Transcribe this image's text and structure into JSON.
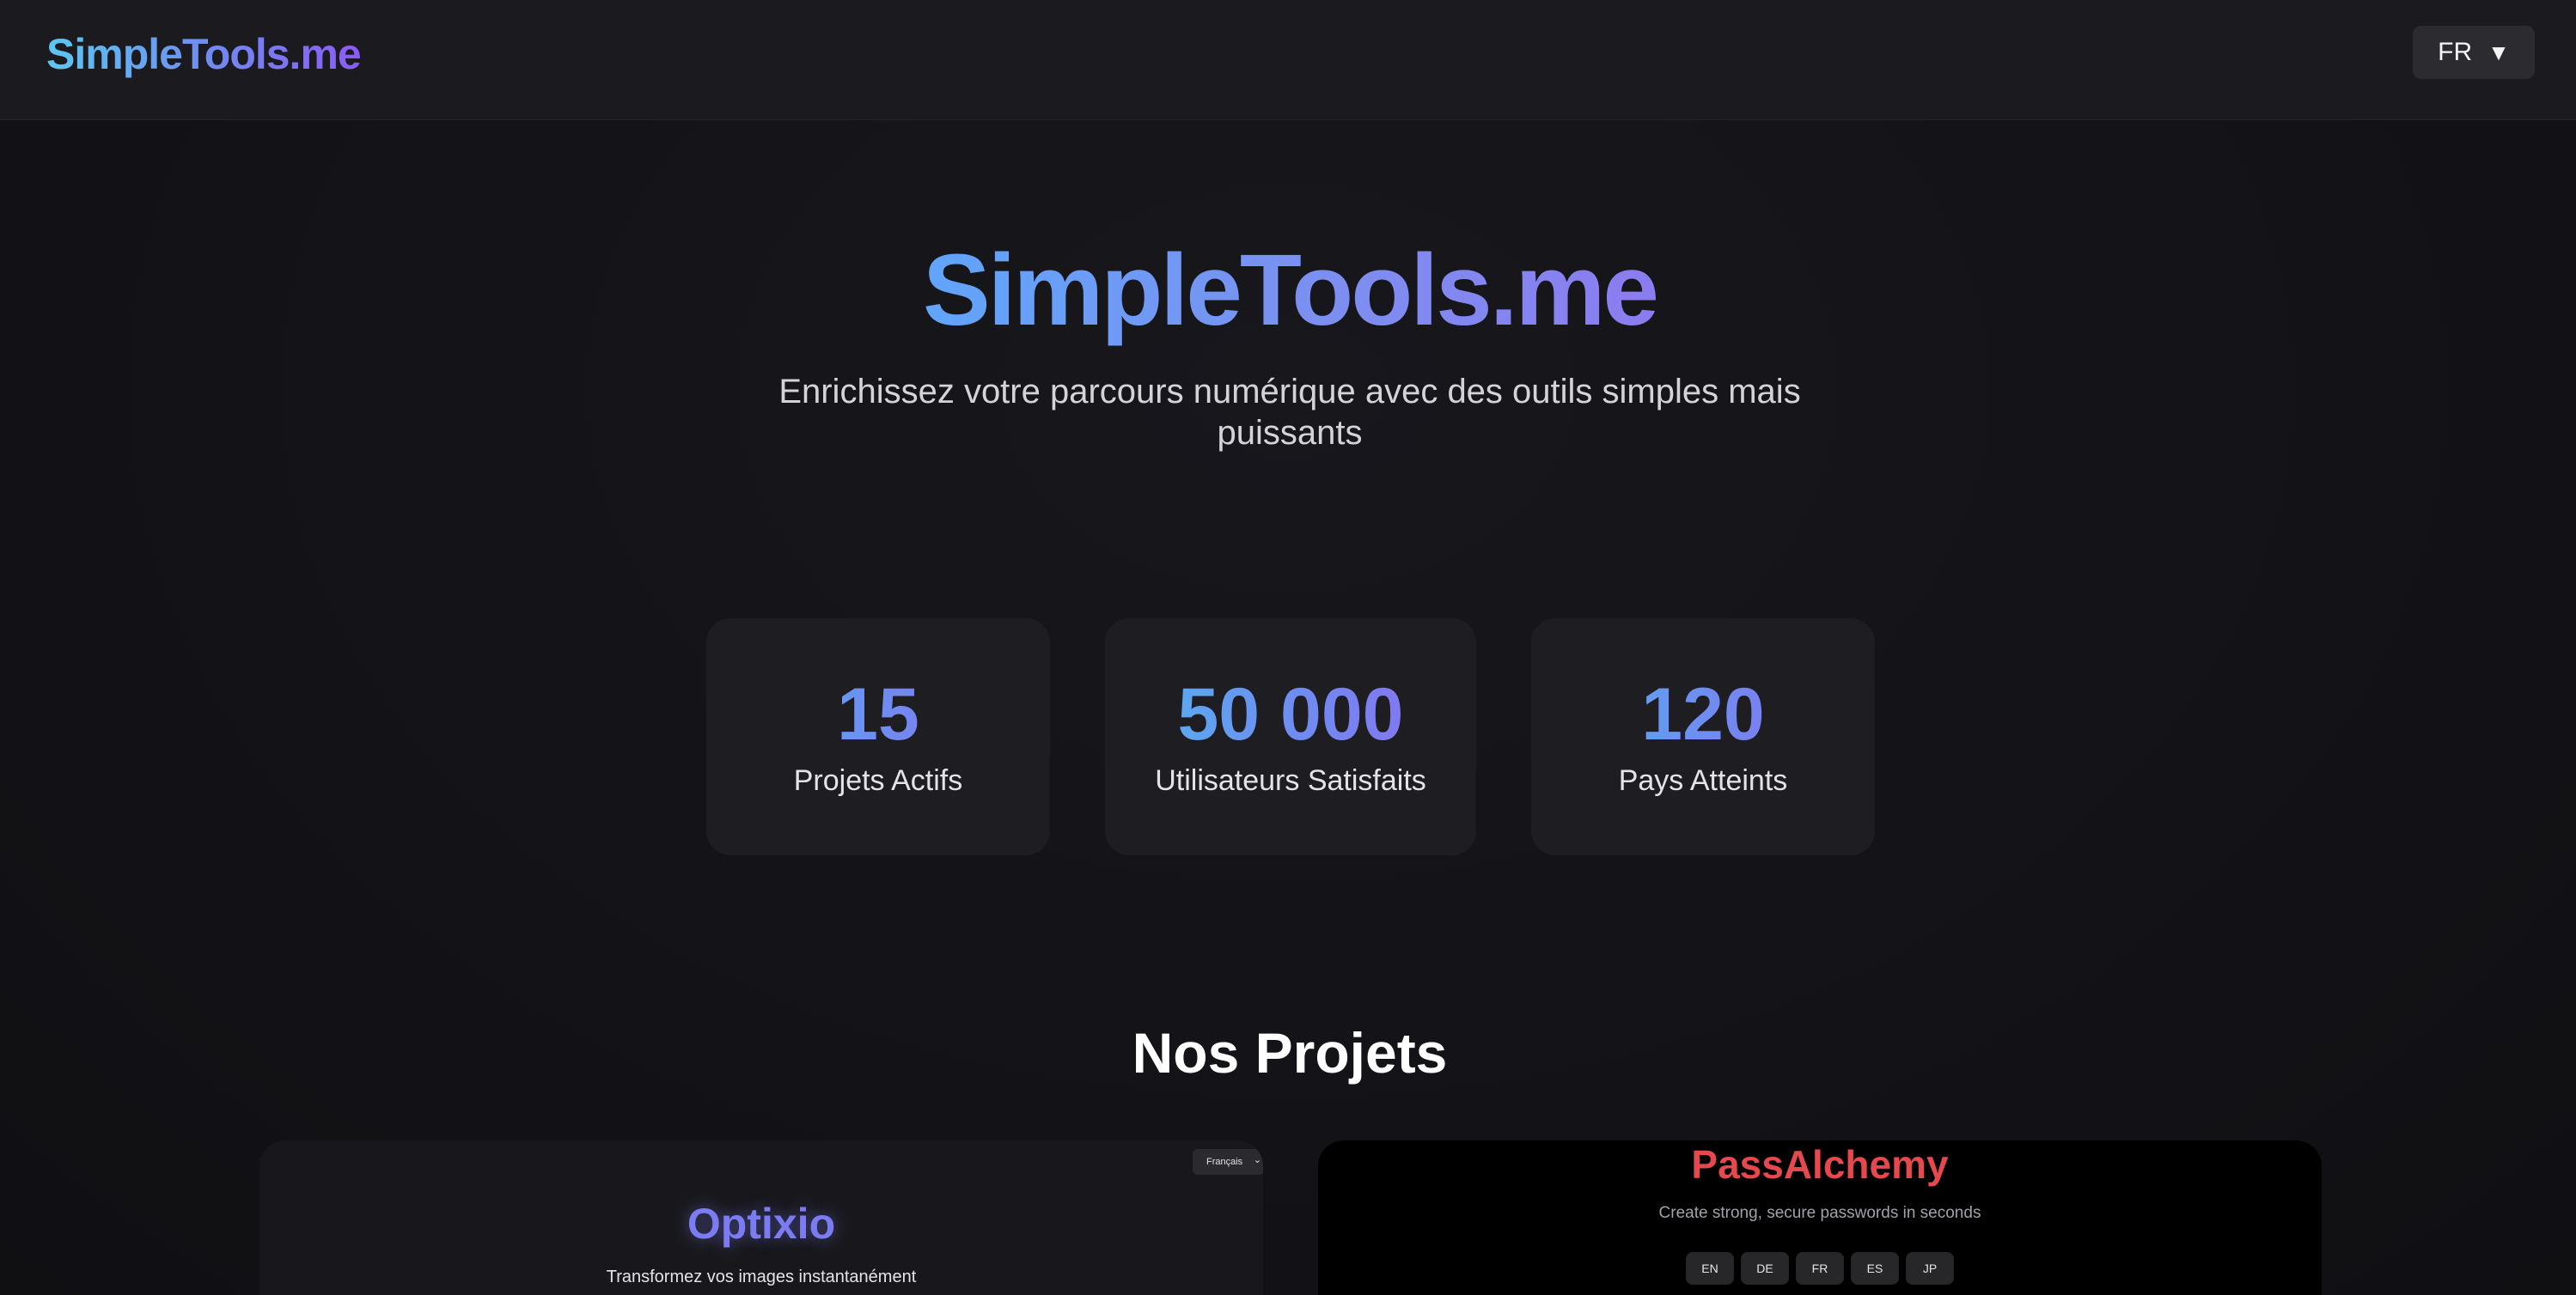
{
  "header": {
    "brand": "SimpleTools.me",
    "language": "FR",
    "language_caret": "▼"
  },
  "hero": {
    "title": "SimpleTools.me",
    "subtitle_line1": "Enrichissez votre parcours numérique avec des outils simples mais",
    "subtitle_line2": "puissants"
  },
  "stats": [
    {
      "value": "15",
      "label": "Projets Actifs"
    },
    {
      "value": "50 000",
      "label": "Utilisateurs Satisfaits"
    },
    {
      "value": "120",
      "label": "Pays Atteints"
    }
  ],
  "projects": {
    "section_title": "Nos Projets",
    "optixio": {
      "title": "Optixio",
      "subtitle": "Transformez vos images instantanément",
      "language_select": "Français",
      "language_chevron": "⌄"
    },
    "passalchemy": {
      "title": "PassAlchemy",
      "subtitle": "Create strong, secure passwords in seconds",
      "languages": [
        "EN",
        "DE",
        "FR",
        "ES",
        "JP"
      ]
    }
  },
  "colors": {
    "background": "#141418",
    "header_bg": "#1b1b1f",
    "card_bg": "#1d1d22",
    "accent_blue": "#60a5fa",
    "accent_purple": "#8b5cf6",
    "passalchemy_red": "#e5484d"
  }
}
